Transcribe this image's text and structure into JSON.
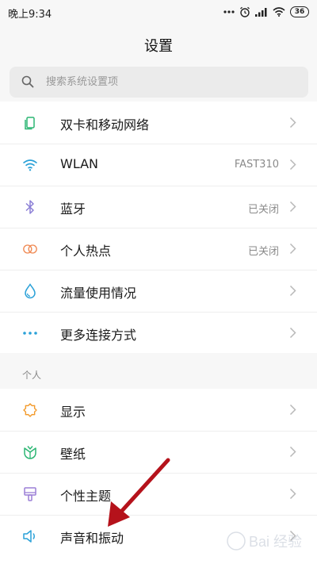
{
  "status_bar": {
    "time": "晚上9:34",
    "battery": "36",
    "icons": [
      "more-dots-icon",
      "alarm-icon",
      "signal-icon",
      "wifi-icon",
      "battery-icon"
    ]
  },
  "page": {
    "title": "设置"
  },
  "search": {
    "placeholder": "搜索系统设置项"
  },
  "network_group": {
    "items": [
      {
        "label": "双卡和移动网络",
        "value": "",
        "icon": "sim-card-icon",
        "color": "#2bb673"
      },
      {
        "label": "WLAN",
        "value": "FAST310",
        "icon": "wifi-icon",
        "color": "#2aa1d8"
      },
      {
        "label": "蓝牙",
        "value": "已关闭",
        "icon": "bluetooth-icon",
        "color": "#8b7fd6"
      },
      {
        "label": "个人热点",
        "value": "已关闭",
        "icon": "hotspot-icon",
        "color": "#f08a54"
      },
      {
        "label": "流量使用情况",
        "value": "",
        "icon": "data-usage-icon",
        "color": "#2aa1d8"
      },
      {
        "label": "更多连接方式",
        "value": "",
        "icon": "more-connections-icon",
        "color": "#2aa1d8"
      }
    ]
  },
  "personal_group": {
    "header": "个人",
    "items": [
      {
        "label": "显示",
        "icon": "brightness-icon",
        "color": "#f39a2b"
      },
      {
        "label": "壁纸",
        "icon": "wallpaper-icon",
        "color": "#2bb673"
      },
      {
        "label": "个性主题",
        "icon": "theme-icon",
        "color": "#9b7fd6"
      },
      {
        "label": "声音和振动",
        "icon": "sound-icon",
        "color": "#2aa1d8"
      }
    ]
  },
  "annotation": {
    "arrow_color": "#b5121b"
  },
  "watermark": {
    "text": "Bai 经验"
  }
}
